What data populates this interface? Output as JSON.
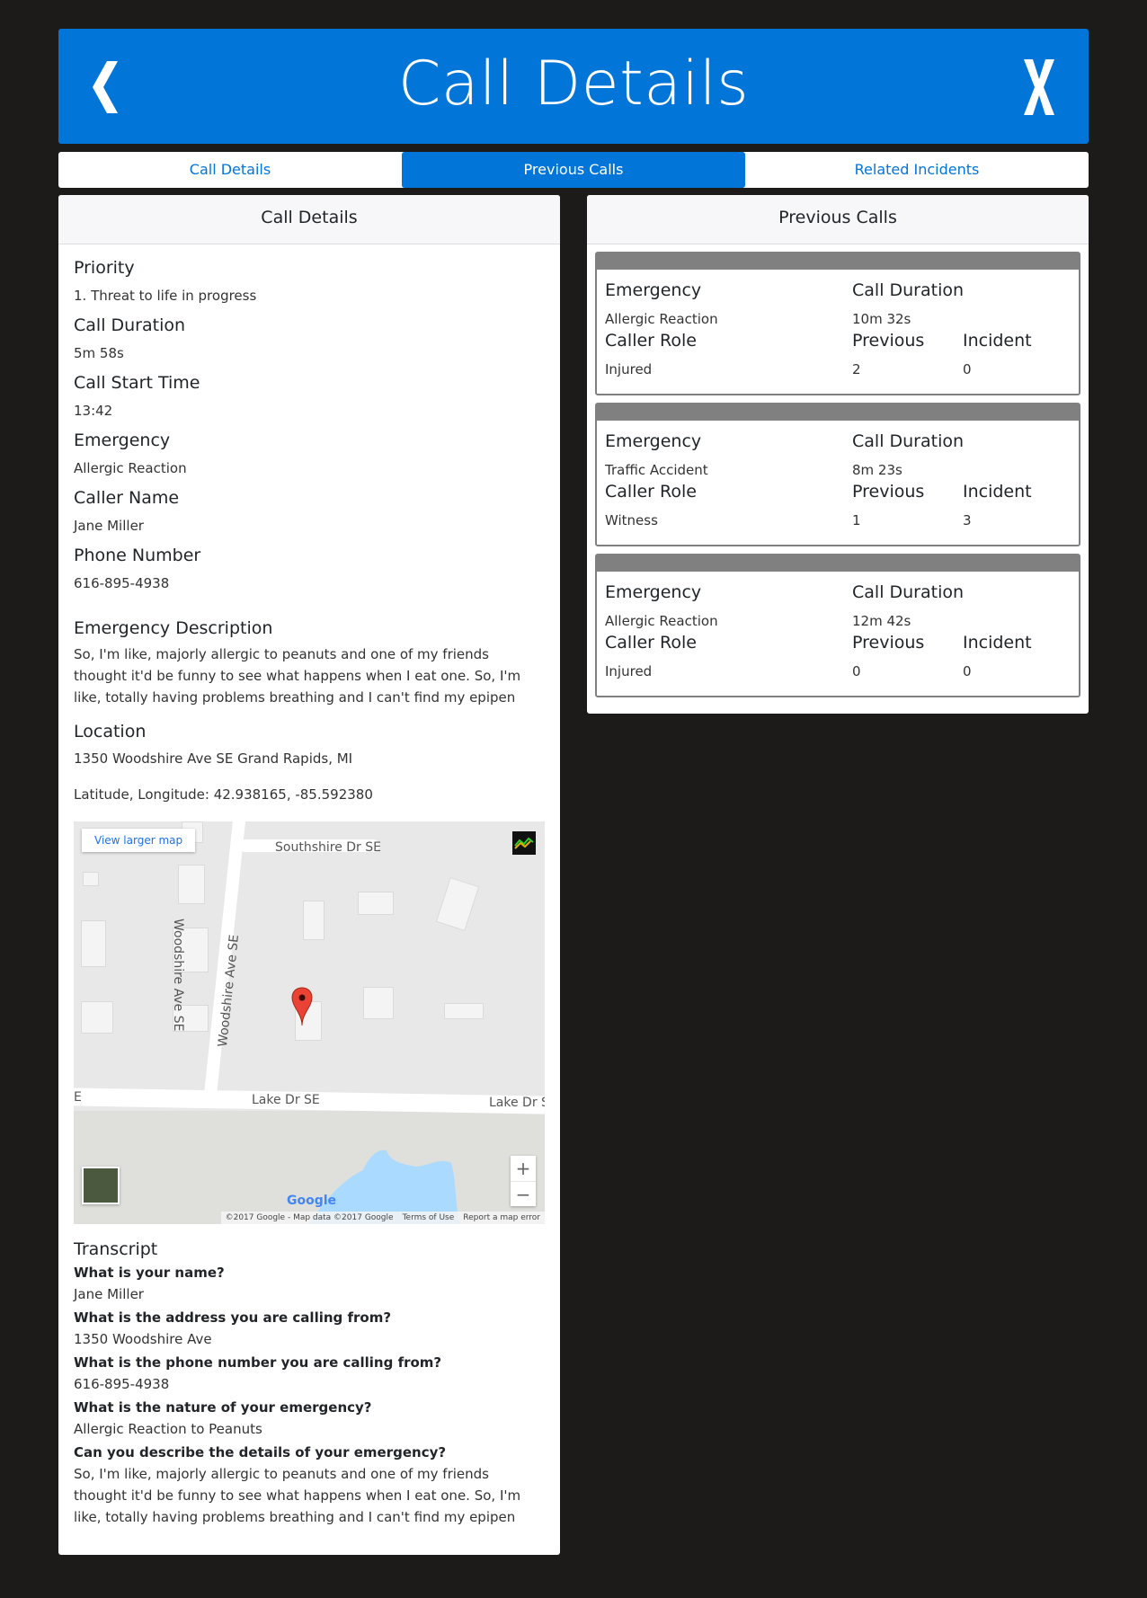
{
  "header": {
    "title": "Call Details"
  },
  "tabs": [
    {
      "label": "Call Details"
    },
    {
      "label": "Previous Calls"
    },
    {
      "label": "Related Incidents"
    }
  ],
  "left": {
    "title": "Call Details",
    "fields": [
      {
        "label": "Priority",
        "value": "1. Threat to life in progress"
      },
      {
        "label": "Call Duration",
        "value": "5m 58s"
      },
      {
        "label": "Call Start Time",
        "value": "13:42"
      },
      {
        "label": "Emergency",
        "value": "Allergic Reaction"
      },
      {
        "label": "Caller Name",
        "value": "Jane Miller"
      },
      {
        "label": "Phone Number",
        "value": "616-895-4938"
      }
    ],
    "description": {
      "label": "Emergency Description",
      "text": "So, I'm like, majorly allergic to peanuts and one of my friends thought it'd be funny to see what happens when I eat one. So, I'm like, totally having problems breathing and I can't find my epipen"
    },
    "location": {
      "label": "Location",
      "address": "1350 Woodshire Ave SE Grand Rapids, MI",
      "coords": "Latitude, Longitude: 42.938165, -85.592380"
    },
    "map": {
      "larger_link": "View larger map",
      "roads": [
        "Southshire Dr SE",
        "Woodshire Ave SE",
        "Woodshire Ave SE",
        "Lake Dr SE",
        "Lake Dr S",
        "E"
      ],
      "google": "Google",
      "attribution": [
        "©2017 Google - Map data ©2017 Google",
        "Terms of Use",
        "Report a map error"
      ],
      "zoom_in": "+",
      "zoom_out": "−"
    },
    "transcript": {
      "label": "Transcript",
      "items": [
        {
          "q": "What is your name?",
          "a": "Jane Miller"
        },
        {
          "q": "What is the address you are calling from?",
          "a": "1350 Woodshire Ave"
        },
        {
          "q": "What is the phone number you are calling from?",
          "a": "616-895-4938"
        },
        {
          "q": "What is the nature of your emergency?",
          "a": "Allergic Reaction to Peanuts"
        },
        {
          "q": "Can you describe the details of your emergency?",
          "a": "So, I'm like, majorly allergic to peanuts and one of my friends thought it'd be funny to see what happens when I eat one. So, I'm like, totally having problems breathing and I can't find my epipen"
        }
      ]
    }
  },
  "right": {
    "title": "Previous Calls",
    "labels": {
      "emergency": "Emergency",
      "duration": "Call Duration",
      "role": "Caller Role",
      "previous": "Previous",
      "incident": "Incident"
    },
    "calls": [
      {
        "emergency": "Allergic Reaction",
        "duration": "10m 32s",
        "role": "Injured",
        "previous": "2",
        "incident": "0"
      },
      {
        "emergency": "Traffic Accident",
        "duration": "8m 23s",
        "role": "Witness",
        "previous": "1",
        "incident": "3"
      },
      {
        "emergency": "Allergic Reaction",
        "duration": "12m 42s",
        "role": "Injured",
        "previous": "0",
        "incident": "0"
      }
    ]
  },
  "colors": {
    "primary": "#0275d8",
    "background": "#1c1b19",
    "card_border": "#808080"
  },
  "icons": {
    "back": "chevron-left-icon",
    "close": "close-x-icon",
    "pin": "map-pin-icon"
  }
}
